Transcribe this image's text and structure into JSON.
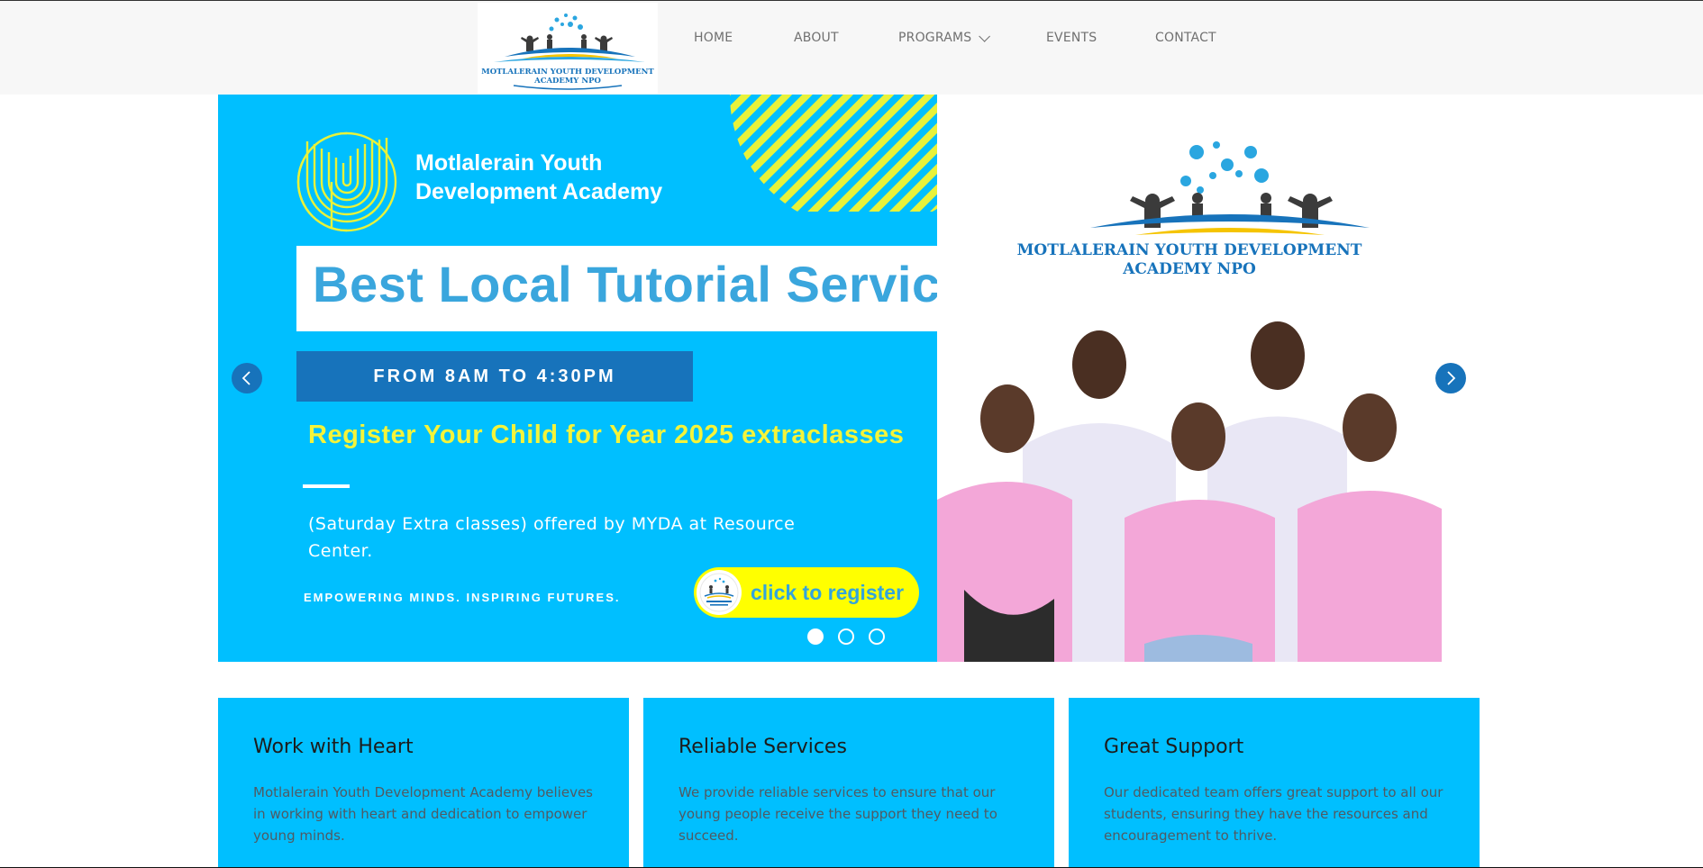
{
  "header": {
    "logo": {
      "icon": "logo-icon",
      "text_line1": "MOTLALERAIN YOUTH DEVELOPMENT",
      "text_line2": "ACADEMY NPO"
    },
    "nav": [
      {
        "label": "HOME"
      },
      {
        "label": "ABOUT"
      },
      {
        "label": "PROGRAMS",
        "icon": "chevron-down-icon"
      },
      {
        "label": "EVENTS"
      },
      {
        "label": "CONTACT"
      }
    ]
  },
  "slider": {
    "banner": {
      "academy_name": "Motlalerain Youth\nDevelopment Academy",
      "headline": "Best Local Tutorial Service",
      "hours": "FROM 8AM TO 4:30PM",
      "register_text": "Register Your Child for Year 2025 extraclasses",
      "description": "(Saturday Extra classes) offered by MYDA at Resource Center.",
      "tagline": "EMPOWERING MINDS. INSPIRING FUTURES.",
      "cta_label": "click to register"
    },
    "photo": {
      "logo_text": "MOTLALERAIN YOUTH DEVELOPMENT\nACADEMY NPO"
    },
    "arrows": {
      "prev_icon": "chevron-left-icon",
      "next_icon": "chevron-right-icon"
    },
    "dots_count": 3,
    "active_slide": 1,
    "colors": {
      "banner_bg": "#00bfff",
      "accent_blue": "#1773bb",
      "yellow": "#ffff00",
      "headline_blue": "#3aa6dd"
    }
  },
  "features": [
    {
      "title": "Work with Heart",
      "text": "Motlalerain Youth Development Academy believes in working with heart and dedication to empower young minds."
    },
    {
      "title": "Reliable Services",
      "text": "We provide reliable services to ensure that our young people receive the support they need to succeed."
    },
    {
      "title": "Great Support",
      "text": "Our dedicated team offers great support to all our students, ensuring they have the resources and encouragement to thrive."
    }
  ]
}
